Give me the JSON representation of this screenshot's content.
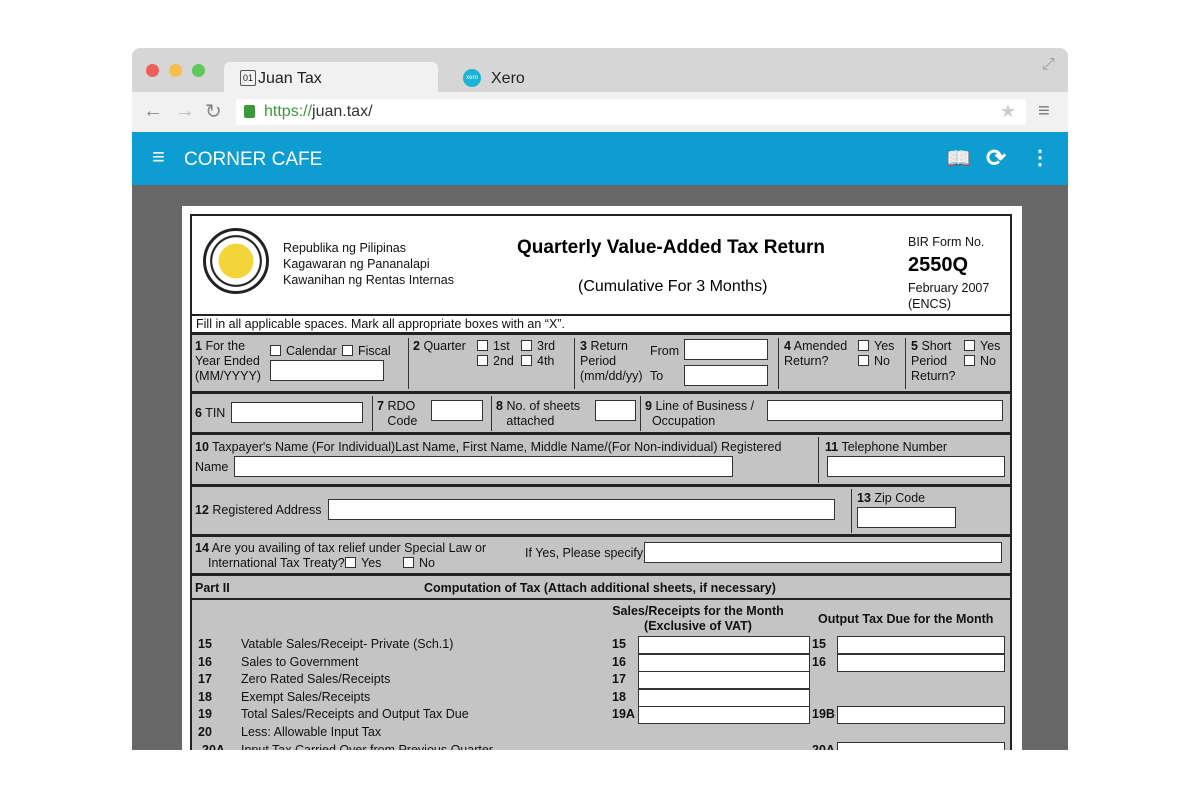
{
  "browser": {
    "tabs": [
      {
        "label": "Juan Tax",
        "icon": "page-01-icon"
      },
      {
        "label": "Xero",
        "icon": "xero-logo-icon"
      }
    ],
    "url_scheme": "https://",
    "url_host": "juan.tax/",
    "colors": {
      "close": "#ee5f5a",
      "min": "#f5be4f",
      "max": "#5fc95b"
    }
  },
  "app": {
    "title": "CORNER CAFE",
    "color": "#0d9dd0"
  },
  "form": {
    "agency": [
      "Republika ng Pilipinas",
      "Kagawaran ng Pananalapi",
      "Kawanihan ng Rentas Internas"
    ],
    "title": "Quarterly Value-Added Tax Return",
    "subtitle": "(Cumulative For 3 Months)",
    "form_no_label": "BIR Form No.",
    "form_no": "2550Q",
    "form_date": "February 2007",
    "form_code": "(ENCS)",
    "instructions": "Fill in all applicable spaces. Mark all appropriate boxes with an “X”.",
    "f1": {
      "num": "1",
      "label": [
        "For the",
        "Year Ended",
        "(MM/YYYY)"
      ],
      "opt1": "Calendar",
      "opt2": "Fiscal"
    },
    "f2": {
      "num": "2",
      "label": "Quarter",
      "q": [
        "1st",
        "3rd",
        "2nd",
        "4th"
      ]
    },
    "f3": {
      "num": "3",
      "label": [
        "Return",
        "Period",
        "(mm/dd/yy)"
      ],
      "from": "From",
      "to": "To"
    },
    "f4": {
      "num": "4",
      "label": [
        "Amended",
        "Return?"
      ],
      "yes": "Yes",
      "no": "No"
    },
    "f5": {
      "num": "5",
      "label": [
        "Short",
        "Period",
        "Return?"
      ],
      "yes": "Yes",
      "no": "No"
    },
    "f6": {
      "num": "6",
      "label": "TIN"
    },
    "f7": {
      "num": "7",
      "label": [
        "RDO",
        "Code"
      ]
    },
    "f8": {
      "num": "8",
      "label": [
        "No. of sheets",
        "attached"
      ]
    },
    "f9": {
      "num": "9",
      "label": [
        "Line of Business /",
        "Occupation"
      ]
    },
    "f10": {
      "num": "10",
      "label": "Taxpayer's Name (For Individual)Last Name, First Name, Middle Name/(For Non-individual) Registered",
      "label2": "Name"
    },
    "f11": {
      "num": "11",
      "label": "Telephone Number"
    },
    "f12": {
      "num": "12",
      "label": "Registered Address"
    },
    "f13": {
      "num": "13",
      "label": "Zip Code"
    },
    "f14": {
      "num": "14",
      "label": "Are you availing of tax relief under Special Law or",
      "label2": "International Tax Treaty?",
      "yes": "Yes",
      "no": "No",
      "specify": "If Yes, Please specify"
    },
    "part2": {
      "part": "Part II",
      "title": "Computation of Tax (Attach additional sheets, if necessary)",
      "col1": [
        "Sales/Receipts for the Month",
        "(Exclusive of VAT)"
      ],
      "col2": "Output Tax Due for the Month",
      "rows": [
        {
          "num": "15",
          "label": "Vatable Sales/Receipt- Private (Sch.1)",
          "a": "15",
          "b": "15"
        },
        {
          "num": "16",
          "label": "Sales to Government",
          "a": "16",
          "b": "16"
        },
        {
          "num": "17",
          "label": "Zero Rated Sales/Receipts",
          "a": "17",
          "b": ""
        },
        {
          "num": "18",
          "label": "Exempt Sales/Receipts",
          "a": "18",
          "b": ""
        },
        {
          "num": "19",
          "label": "Total Sales/Receipts and Output Tax Due",
          "a": "19A",
          "b": "19B"
        },
        {
          "num": "20",
          "label": "Less: Allowable Input Tax",
          "a": "",
          "b": ""
        },
        {
          "num": "20A",
          "label": "Input Tax Carried Over from Previous Quarter",
          "a": "",
          "b": "20A"
        }
      ]
    }
  }
}
